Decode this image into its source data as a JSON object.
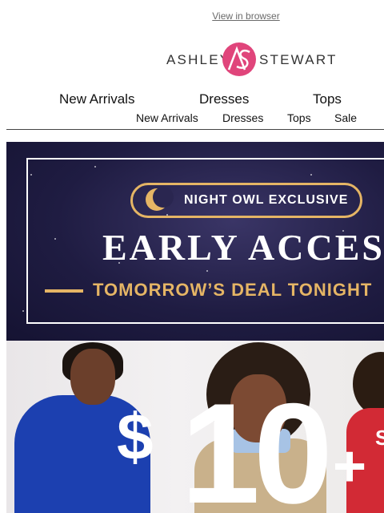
{
  "header": {
    "view_in_browser": "View in browser",
    "logo_left": "ASHLEY",
    "logo_right": "STEWART",
    "logo_monogram": "AS"
  },
  "nav_primary": [
    "New Arrivals",
    "Dresses",
    "Tops"
  ],
  "nav_secondary": [
    "New Arrivals",
    "Dresses",
    "Tops",
    "Sale"
  ],
  "hero": {
    "badge": "NIGHT OWL EXCLUSIVE",
    "headline": "EARLY ACCESS",
    "subheadline": "TOMORROW’S DEAL TONIGHT",
    "price_symbol": "$",
    "price_value": "10",
    "price_suffix": "+",
    "shirt_letter": "S"
  },
  "colors": {
    "brand_pink": "#e0457b",
    "gold": "#e5b565",
    "night": "#1f1c42"
  }
}
